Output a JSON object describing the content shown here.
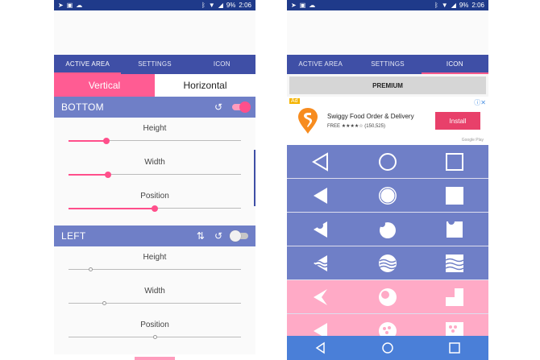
{
  "status": {
    "battery": "9%",
    "time": "2:06"
  },
  "tabs": [
    "ACTIVE AREA",
    "SETTINGS",
    "ICON"
  ],
  "left": {
    "active_tab": 0,
    "orientation": {
      "vertical": "Vertical",
      "horizontal": "Horizontal",
      "selected": "vertical"
    },
    "sections": [
      {
        "title": "BOTTOM",
        "enabled": true,
        "show_swap": false,
        "sliders": [
          {
            "label": "Height",
            "value": 0.22
          },
          {
            "label": "Width",
            "value": 0.23
          },
          {
            "label": "Position",
            "value": 0.5
          }
        ]
      },
      {
        "title": "LEFT",
        "enabled": false,
        "show_swap": true,
        "sliders": [
          {
            "label": "Height",
            "value": 0.13
          },
          {
            "label": "Width",
            "value": 0.21
          },
          {
            "label": "Position",
            "value": 0.5
          }
        ]
      }
    ]
  },
  "right": {
    "active_tab": 2,
    "premium_label": "PREMIUM",
    "ad": {
      "badge": "Ad",
      "title": "Swiggy Food Order & Delivery",
      "free": "FREE",
      "rating": "★★★★☆",
      "reviews": "(150,525)",
      "install": "Install",
      "store": "Google Play"
    },
    "icon_rows": [
      {
        "style": "blue",
        "icons": [
          "triangle-outline",
          "circle-outline",
          "square-outline"
        ]
      },
      {
        "style": "blue",
        "icons": [
          "triangle-filled",
          "circle-filled",
          "square-filled"
        ]
      },
      {
        "style": "blue",
        "icons": [
          "triangle-bite",
          "circle-bite",
          "square-bite"
        ]
      },
      {
        "style": "blue",
        "icons": [
          "triangle-wave",
          "circle-wave",
          "square-wave"
        ]
      },
      {
        "style": "pink",
        "icons": [
          "triangle-notch",
          "circle-eye",
          "square-corner"
        ]
      },
      {
        "style": "pink",
        "icons": [
          "triangle-pattern",
          "circle-pattern",
          "square-pattern"
        ]
      }
    ]
  },
  "colors": {
    "primary": "#3f4fa6",
    "accent": "#ff5c93",
    "section": "#6f7fc7"
  }
}
